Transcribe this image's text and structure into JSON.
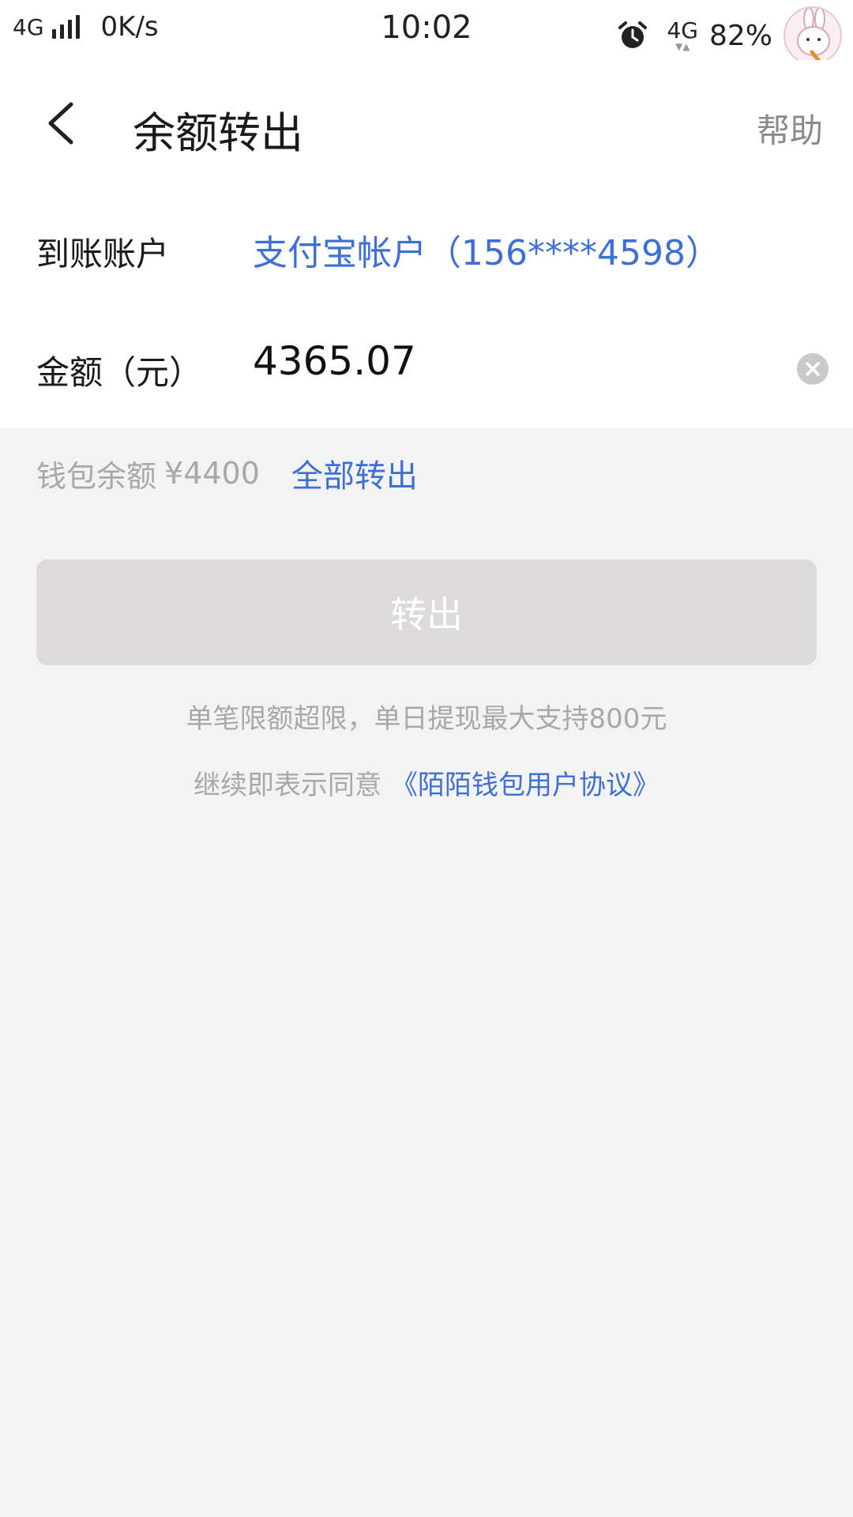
{
  "status_bar": {
    "network_left": "4G",
    "speed": "0K/s",
    "time": "10:02",
    "network_right": "4G",
    "battery": "82%"
  },
  "header": {
    "title": "余额转出",
    "help_label": "帮助"
  },
  "form": {
    "account_label": "到账账户",
    "account_value": "支付宝帐户（156****4598）",
    "amount_label": "金额（元）",
    "amount_value": "4365.07"
  },
  "balance": {
    "label": "钱包余额",
    "amount": "¥4400",
    "withdraw_all_label": "全部转出"
  },
  "submit_label": "转出",
  "limit_tip": "单笔限额超限，单日提现最大支持800元",
  "agreement": {
    "prefix": "继续即表示同意",
    "link": "《陌陌钱包用户协议》"
  },
  "colors": {
    "accent": "#3e6fd7",
    "muted_text": "#a8a8a8",
    "disabled_button": "#dcdbda",
    "background": "#f3f3f3"
  },
  "icons": [
    "signal-icon",
    "alarm-icon",
    "avatar",
    "back-arrow-icon",
    "clear-icon"
  ]
}
